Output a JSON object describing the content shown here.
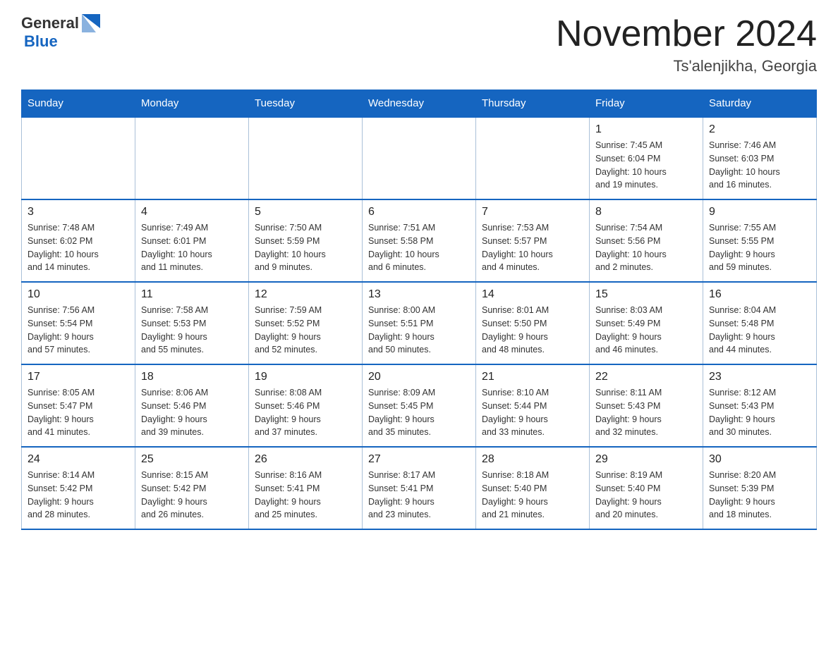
{
  "header": {
    "logo_general": "General",
    "logo_blue": "Blue",
    "month_title": "November 2024",
    "location": "Ts'alenjikha, Georgia"
  },
  "days_of_week": [
    "Sunday",
    "Monday",
    "Tuesday",
    "Wednesday",
    "Thursday",
    "Friday",
    "Saturday"
  ],
  "weeks": [
    {
      "days": [
        {
          "num": "",
          "info": "",
          "empty": true
        },
        {
          "num": "",
          "info": "",
          "empty": true
        },
        {
          "num": "",
          "info": "",
          "empty": true
        },
        {
          "num": "",
          "info": "",
          "empty": true
        },
        {
          "num": "",
          "info": "",
          "empty": true
        },
        {
          "num": "1",
          "info": "Sunrise: 7:45 AM\nSunset: 6:04 PM\nDaylight: 10 hours\nand 19 minutes."
        },
        {
          "num": "2",
          "info": "Sunrise: 7:46 AM\nSunset: 6:03 PM\nDaylight: 10 hours\nand 16 minutes."
        }
      ]
    },
    {
      "days": [
        {
          "num": "3",
          "info": "Sunrise: 7:48 AM\nSunset: 6:02 PM\nDaylight: 10 hours\nand 14 minutes."
        },
        {
          "num": "4",
          "info": "Sunrise: 7:49 AM\nSunset: 6:01 PM\nDaylight: 10 hours\nand 11 minutes."
        },
        {
          "num": "5",
          "info": "Sunrise: 7:50 AM\nSunset: 5:59 PM\nDaylight: 10 hours\nand 9 minutes."
        },
        {
          "num": "6",
          "info": "Sunrise: 7:51 AM\nSunset: 5:58 PM\nDaylight: 10 hours\nand 6 minutes."
        },
        {
          "num": "7",
          "info": "Sunrise: 7:53 AM\nSunset: 5:57 PM\nDaylight: 10 hours\nand 4 minutes."
        },
        {
          "num": "8",
          "info": "Sunrise: 7:54 AM\nSunset: 5:56 PM\nDaylight: 10 hours\nand 2 minutes."
        },
        {
          "num": "9",
          "info": "Sunrise: 7:55 AM\nSunset: 5:55 PM\nDaylight: 9 hours\nand 59 minutes."
        }
      ]
    },
    {
      "days": [
        {
          "num": "10",
          "info": "Sunrise: 7:56 AM\nSunset: 5:54 PM\nDaylight: 9 hours\nand 57 minutes."
        },
        {
          "num": "11",
          "info": "Sunrise: 7:58 AM\nSunset: 5:53 PM\nDaylight: 9 hours\nand 55 minutes."
        },
        {
          "num": "12",
          "info": "Sunrise: 7:59 AM\nSunset: 5:52 PM\nDaylight: 9 hours\nand 52 minutes."
        },
        {
          "num": "13",
          "info": "Sunrise: 8:00 AM\nSunset: 5:51 PM\nDaylight: 9 hours\nand 50 minutes."
        },
        {
          "num": "14",
          "info": "Sunrise: 8:01 AM\nSunset: 5:50 PM\nDaylight: 9 hours\nand 48 minutes."
        },
        {
          "num": "15",
          "info": "Sunrise: 8:03 AM\nSunset: 5:49 PM\nDaylight: 9 hours\nand 46 minutes."
        },
        {
          "num": "16",
          "info": "Sunrise: 8:04 AM\nSunset: 5:48 PM\nDaylight: 9 hours\nand 44 minutes."
        }
      ]
    },
    {
      "days": [
        {
          "num": "17",
          "info": "Sunrise: 8:05 AM\nSunset: 5:47 PM\nDaylight: 9 hours\nand 41 minutes."
        },
        {
          "num": "18",
          "info": "Sunrise: 8:06 AM\nSunset: 5:46 PM\nDaylight: 9 hours\nand 39 minutes."
        },
        {
          "num": "19",
          "info": "Sunrise: 8:08 AM\nSunset: 5:46 PM\nDaylight: 9 hours\nand 37 minutes."
        },
        {
          "num": "20",
          "info": "Sunrise: 8:09 AM\nSunset: 5:45 PM\nDaylight: 9 hours\nand 35 minutes."
        },
        {
          "num": "21",
          "info": "Sunrise: 8:10 AM\nSunset: 5:44 PM\nDaylight: 9 hours\nand 33 minutes."
        },
        {
          "num": "22",
          "info": "Sunrise: 8:11 AM\nSunset: 5:43 PM\nDaylight: 9 hours\nand 32 minutes."
        },
        {
          "num": "23",
          "info": "Sunrise: 8:12 AM\nSunset: 5:43 PM\nDaylight: 9 hours\nand 30 minutes."
        }
      ]
    },
    {
      "days": [
        {
          "num": "24",
          "info": "Sunrise: 8:14 AM\nSunset: 5:42 PM\nDaylight: 9 hours\nand 28 minutes."
        },
        {
          "num": "25",
          "info": "Sunrise: 8:15 AM\nSunset: 5:42 PM\nDaylight: 9 hours\nand 26 minutes."
        },
        {
          "num": "26",
          "info": "Sunrise: 8:16 AM\nSunset: 5:41 PM\nDaylight: 9 hours\nand 25 minutes."
        },
        {
          "num": "27",
          "info": "Sunrise: 8:17 AM\nSunset: 5:41 PM\nDaylight: 9 hours\nand 23 minutes."
        },
        {
          "num": "28",
          "info": "Sunrise: 8:18 AM\nSunset: 5:40 PM\nDaylight: 9 hours\nand 21 minutes."
        },
        {
          "num": "29",
          "info": "Sunrise: 8:19 AM\nSunset: 5:40 PM\nDaylight: 9 hours\nand 20 minutes."
        },
        {
          "num": "30",
          "info": "Sunrise: 8:20 AM\nSunset: 5:39 PM\nDaylight: 9 hours\nand 18 minutes."
        }
      ]
    }
  ]
}
